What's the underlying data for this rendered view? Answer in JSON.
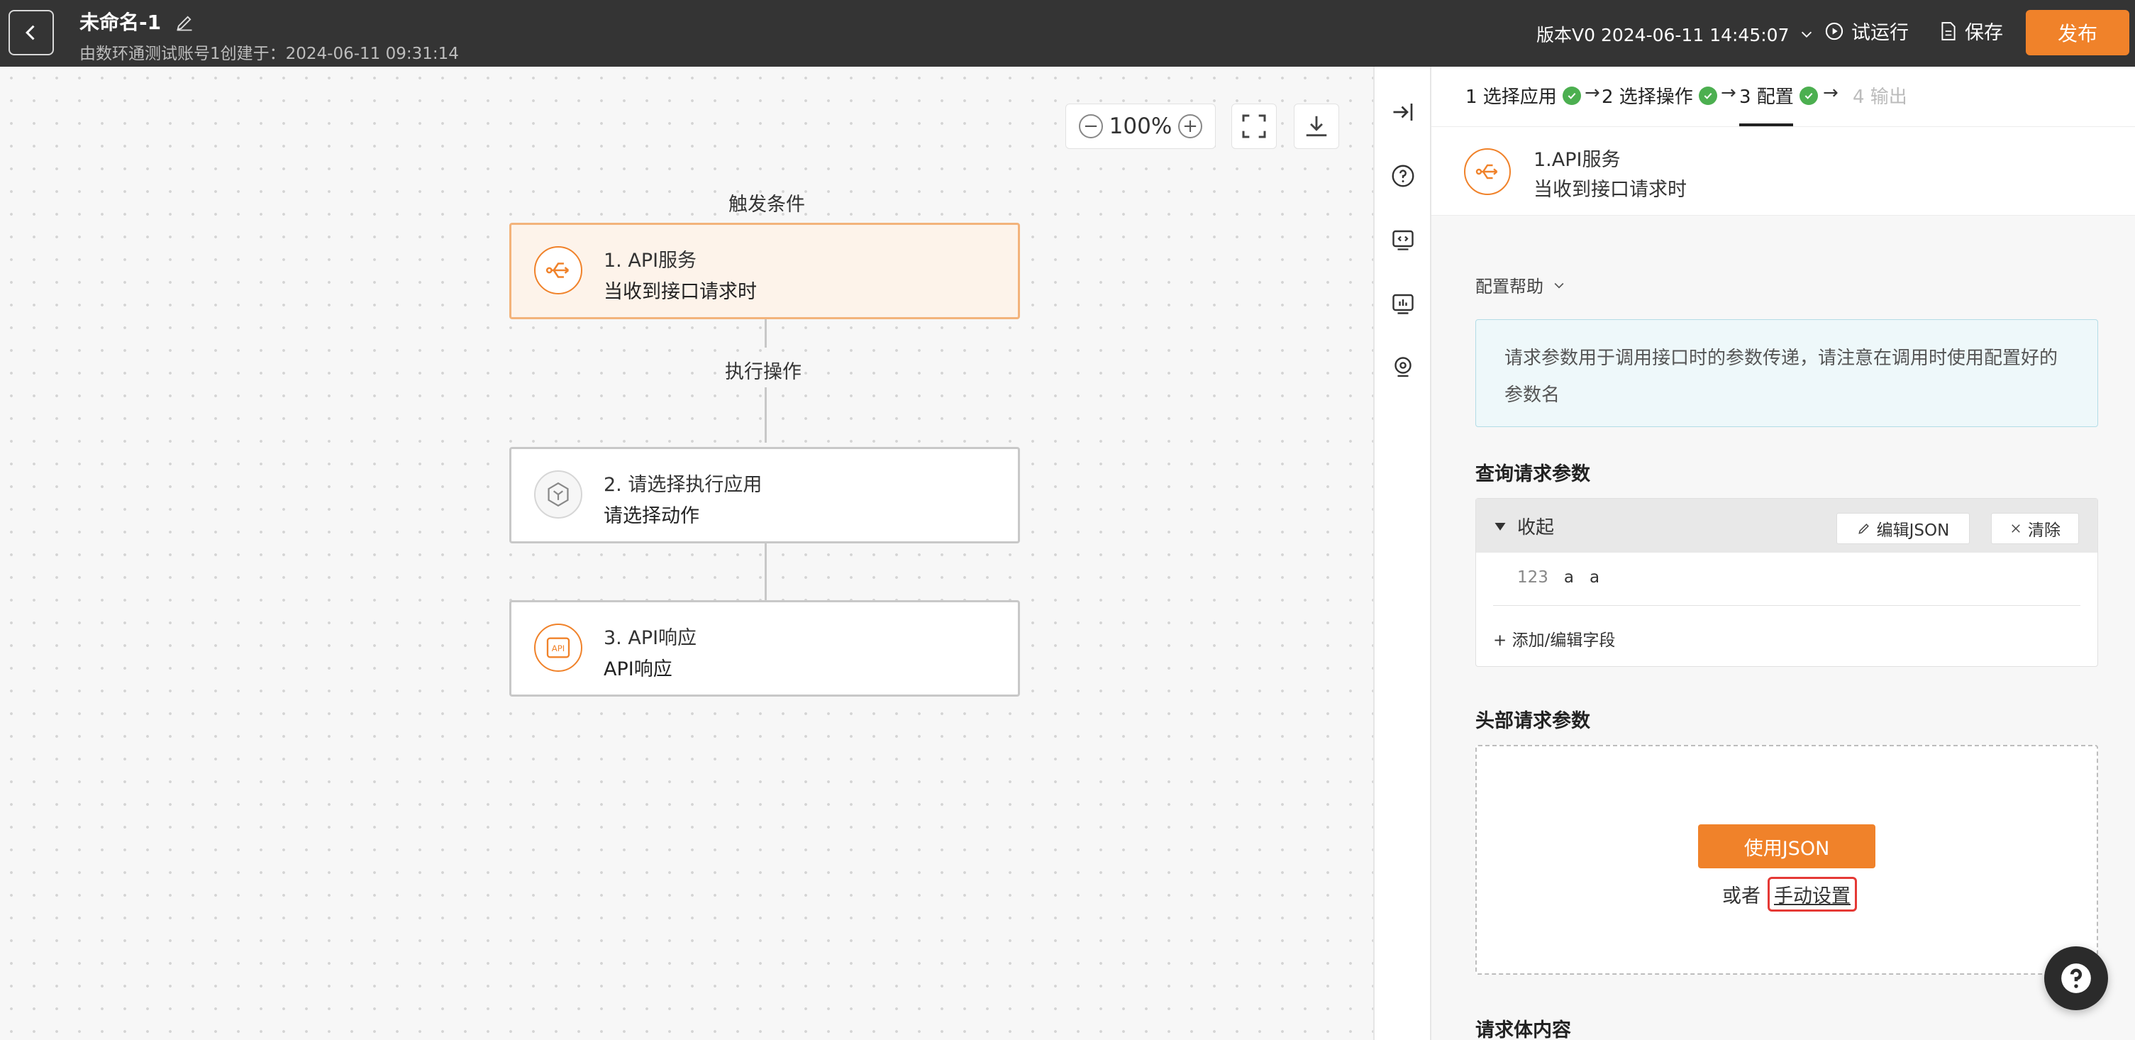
{
  "header": {
    "title": "未命名-1",
    "subtitle": "由数环通测试账号1创建于：2024-06-11 09:31:14",
    "version": "版本V0 2024-06-11 14:45:07",
    "test_run": "试运行",
    "save": "保存",
    "publish": "发布"
  },
  "canvas": {
    "zoom": "100%",
    "trigger_label": "触发条件",
    "action_label": "执行操作",
    "nodes": [
      {
        "title": "1. API服务",
        "subtitle": "当收到接口请求时"
      },
      {
        "title": "2. 请选择执行应用",
        "subtitle": "请选择动作"
      },
      {
        "title": "3. API响应",
        "subtitle": "API响应"
      }
    ],
    "api_icon_text": "API"
  },
  "panel": {
    "steps": [
      "1 选择应用",
      "2 选择操作",
      "3 配置",
      "4 输出"
    ],
    "node_title": "1.API服务",
    "node_subtitle": "当收到接口请求时",
    "help_toggle": "配置帮助",
    "info_text": "请求参数用于调用接口时的参数传递，请注意在调用时使用配置好的参数名",
    "query_title": "查询请求参数",
    "collapse": "收起",
    "edit_json": "编辑JSON",
    "clear": "清除",
    "field_type": "123",
    "field_name": "a",
    "field_value": "a",
    "add_field": "+ 添加/编辑字段",
    "header_title": "头部请求参数",
    "use_json": "使用JSON",
    "or": "或者",
    "manual": "手动设置",
    "body_title": "请求体内容"
  },
  "colors": {
    "accent": "#f0822a",
    "success": "#4caf50",
    "topbar": "#343434"
  }
}
